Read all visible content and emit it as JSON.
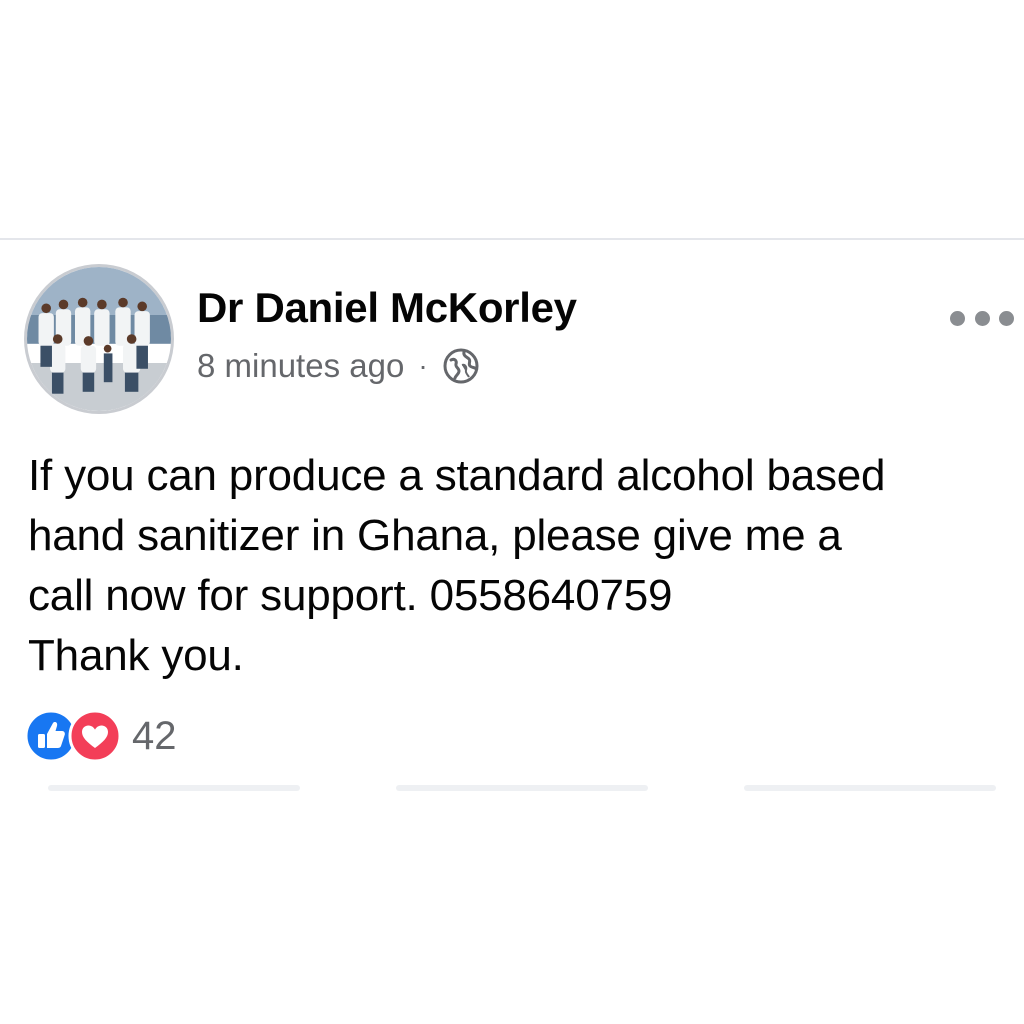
{
  "post": {
    "author": "Dr Daniel McKorley",
    "timestamp": "8 minutes ago",
    "separator": "·",
    "privacy_icon": "globe-icon",
    "menu_icon": "more-options-icon",
    "text": "If you can produce a standard alcohol based\nhand sanitizer in Ghana, please give me a\ncall now for support. 0558640759\nThank you.",
    "reactions": {
      "icons": [
        "like-icon",
        "love-icon"
      ],
      "count": "42"
    }
  },
  "colors": {
    "like": "#1877f2",
    "love": "#f33e58",
    "secondary_text": "#65676b",
    "primary_text": "#050505"
  }
}
